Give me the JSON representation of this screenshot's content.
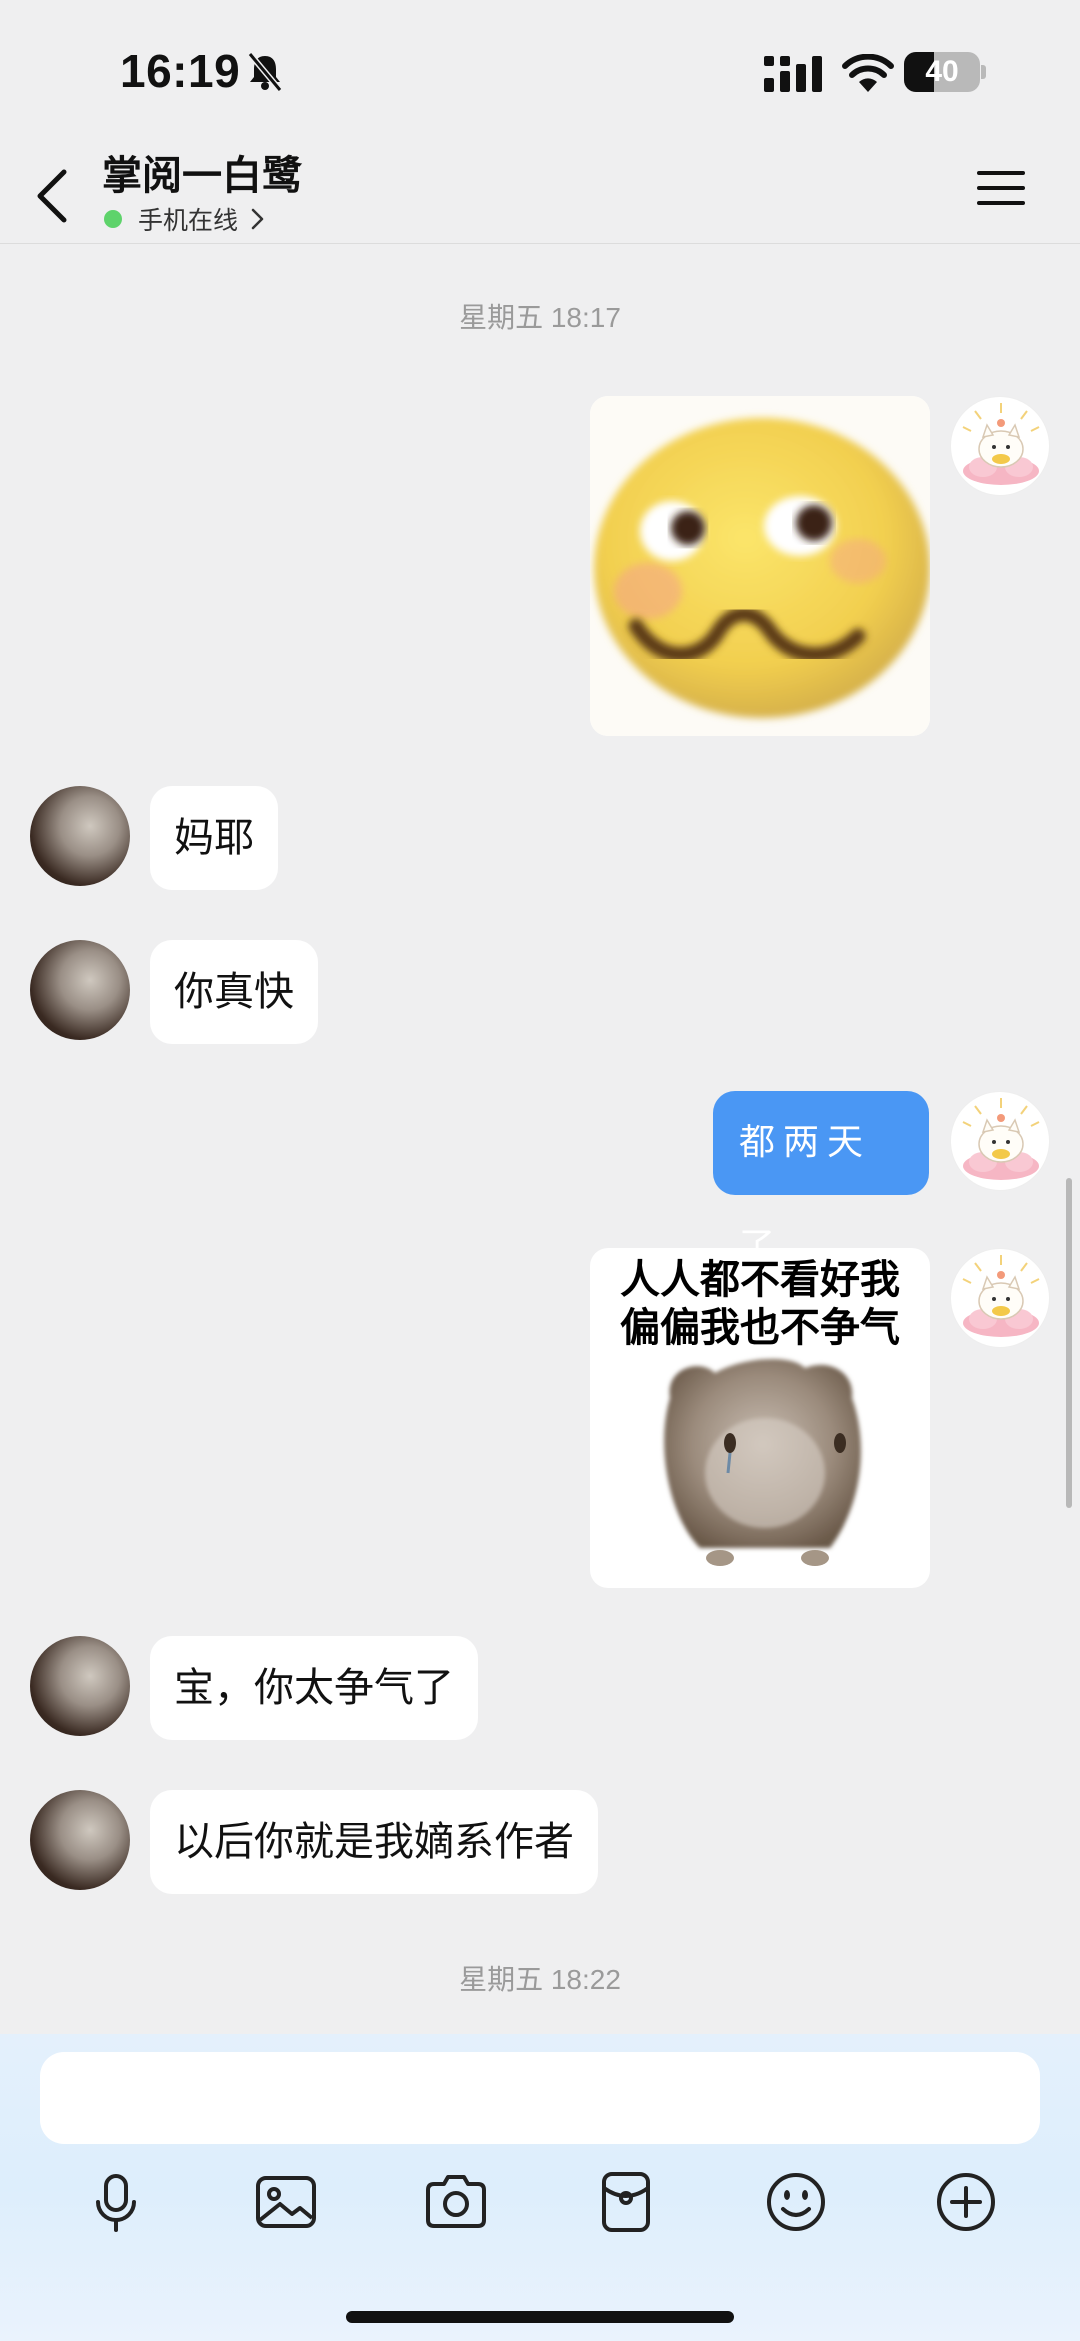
{
  "status_bar": {
    "time": "16:19",
    "battery": "40",
    "battery_level": 0.4
  },
  "header": {
    "title": "掌阅一白鹭",
    "online_status": "手机在线"
  },
  "timestamps": [
    "星期五 18:17",
    "星期五 18:22"
  ],
  "messages": {
    "m2": "妈耶",
    "m3": "你真快",
    "m4": "都两天了",
    "m5_caption_line1": "人人都不看好我",
    "m5_caption_line2": "偏偏我也不争气",
    "m6": "宝，你太争气了",
    "m7": "以后你就是我嫡系作者"
  },
  "composer": {
    "placeholder": ""
  },
  "toolbar_icons": [
    "microphone-icon",
    "image-icon",
    "camera-icon",
    "red-packet-icon",
    "emoji-icon",
    "plus-icon"
  ],
  "colors": {
    "accent_blue": "#4a97f4",
    "online_green": "#5ed36b",
    "background": "#efeff0"
  }
}
